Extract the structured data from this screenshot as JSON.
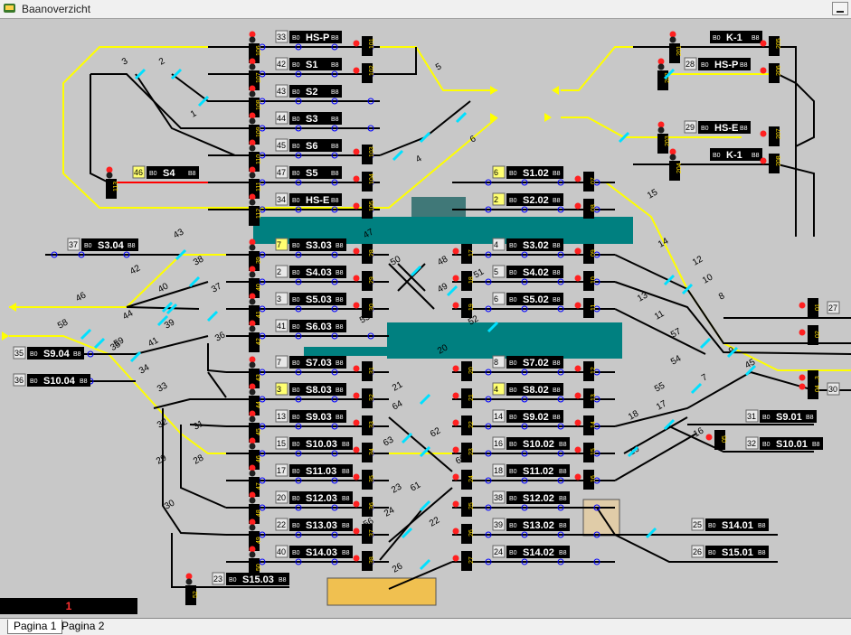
{
  "window": {
    "title": "Baanoverzicht"
  },
  "status_counter": "1",
  "tabs": [
    {
      "label": "Pagina 1"
    },
    {
      "label": "Pagina 2"
    }
  ],
  "colors": {
    "background": "#c8c8c8",
    "track": "#000000",
    "highlight_route": "#ffff00",
    "occupied_route": "#ff0000",
    "platform": "#008080",
    "sensor": "#00e0ff",
    "label_box": "#000000",
    "sensor_ring": "#0000ff",
    "status_text": "#ff3030"
  },
  "blocks": [
    {
      "num": "33",
      "name": "HS-P",
      "sig": "106"
    },
    {
      "num": "42",
      "name": "S1",
      "sig": "107"
    },
    {
      "num": "43",
      "name": "S2",
      "sig": "108"
    },
    {
      "num": "44",
      "name": "S3",
      "sig": "109"
    },
    {
      "num": "45",
      "name": "S6",
      "sig": "110"
    },
    {
      "num": "47",
      "name": "S5",
      "sig": "111"
    },
    {
      "num": "46",
      "name": "S4",
      "sig": "113"
    },
    {
      "num": "34",
      "name": "HS-E",
      "sig": "112"
    },
    {
      "num": "37",
      "name": "S3.04"
    },
    {
      "num": "7",
      "name": "S3.03",
      "sig": "39"
    },
    {
      "num": "2",
      "name": "S4.03",
      "sig": "40"
    },
    {
      "num": "3",
      "name": "S5.03",
      "sig": "41"
    },
    {
      "num": "41",
      "name": "S6.03",
      "sig": "42"
    },
    {
      "num": "7",
      "name": "S7.03",
      "sig": "43"
    },
    {
      "num": "3",
      "name": "S8.03",
      "sig": "44"
    },
    {
      "num": "13",
      "name": "S9.03",
      "sig": "45"
    },
    {
      "num": "15",
      "name": "S10.03",
      "sig": "46"
    },
    {
      "num": "17",
      "name": "S11.03",
      "sig": "47"
    },
    {
      "num": "20",
      "name": "S12.03",
      "sig": "48"
    },
    {
      "num": "22",
      "name": "S13.03",
      "sig": "49"
    },
    {
      "num": "40",
      "name": "S14.03",
      "sig": "50"
    },
    {
      "num": "23",
      "name": "S15.03",
      "sig": "52"
    },
    {
      "num": "35",
      "name": "S9.04",
      "sig": "55"
    },
    {
      "num": "36",
      "name": "S10.04",
      "sig": "56"
    },
    {
      "num": "6",
      "name": "S1.02"
    },
    {
      "num": "2",
      "name": "S2.02"
    },
    {
      "num": "4",
      "name": "S3.02"
    },
    {
      "num": "5",
      "name": "S4.02"
    },
    {
      "num": "6",
      "name": "S5.02"
    },
    {
      "num": "8",
      "name": "S7.02"
    },
    {
      "num": "4",
      "name": "S8.02"
    },
    {
      "num": "14",
      "name": "S9.02"
    },
    {
      "num": "16",
      "name": "S10.02"
    },
    {
      "num": "18",
      "name": "S11.02"
    },
    {
      "num": "38",
      "name": "S12.02"
    },
    {
      "num": "39",
      "name": "S13.02"
    },
    {
      "num": "24",
      "name": "S14.02"
    },
    {
      "num": "25",
      "name": "S14.01"
    },
    {
      "num": "26",
      "name": "S15.01"
    },
    {
      "num": "31",
      "name": "S9.01"
    },
    {
      "num": "32",
      "name": "S10.01"
    },
    {
      "num": "27",
      "name": ""
    },
    {
      "num": "30",
      "name": ""
    },
    {
      "num": "",
      "name": "K-1",
      "sig": "201"
    },
    {
      "num": "28",
      "name": "HS-P",
      "sig": "202"
    },
    {
      "num": "29",
      "name": "HS-E",
      "sig": "203"
    },
    {
      "num": "",
      "name": "K-1",
      "sig": "204"
    }
  ],
  "point_labels": [
    "1",
    "2",
    "3",
    "4",
    "5",
    "6",
    "7",
    "8",
    "9",
    "10",
    "11",
    "12",
    "13",
    "14",
    "15",
    "16",
    "17",
    "18",
    "19",
    "20",
    "21",
    "22",
    "23",
    "24",
    "26",
    "28",
    "29",
    "30",
    "31",
    "32",
    "33",
    "34",
    "36",
    "37",
    "38",
    "39",
    "40",
    "41",
    "42",
    "43",
    "44",
    "45",
    "46",
    "47",
    "48",
    "49",
    "50",
    "51",
    "52",
    "53",
    "54",
    "55",
    "56",
    "57",
    "58",
    "59",
    "60",
    "61",
    "62",
    "63",
    "64"
  ],
  "signal_labels": [
    "01",
    "02",
    "03",
    "04",
    "05",
    "06",
    "07",
    "08",
    "09",
    "10",
    "11",
    "12",
    "13",
    "14",
    "15",
    "16",
    "17",
    "18",
    "19",
    "20",
    "21",
    "22",
    "23",
    "24",
    "25",
    "26",
    "27",
    "28",
    "29",
    "30",
    "31",
    "32",
    "33",
    "34",
    "35",
    "36",
    "37",
    "38",
    "101",
    "102",
    "103",
    "104",
    "105",
    "205",
    "206",
    "207",
    "208"
  ]
}
